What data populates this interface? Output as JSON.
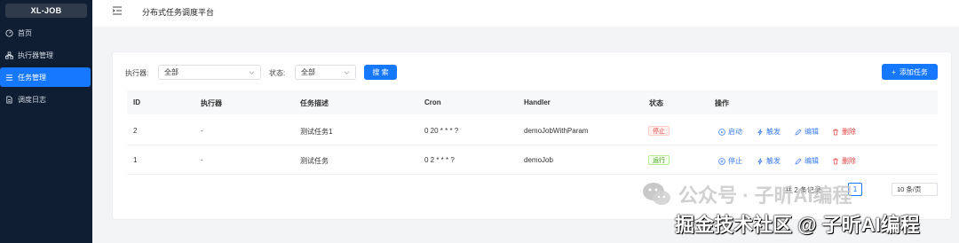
{
  "sidebar": {
    "logo": "XL-JOB",
    "items": [
      {
        "label": "首页",
        "icon": "dashboard-icon",
        "active": false
      },
      {
        "label": "执行器管理",
        "icon": "cluster-icon",
        "active": false
      },
      {
        "label": "任务管理",
        "icon": "list-icon",
        "active": true
      },
      {
        "label": "调度日志",
        "icon": "file-icon",
        "active": false
      }
    ]
  },
  "header": {
    "title": "分布式任务调度平台"
  },
  "filters": {
    "executor_label": "执行器:",
    "executor_value": "全部",
    "status_label": "状态:",
    "status_value": "全部",
    "search_label": "搜 索",
    "add_label": "添加任务"
  },
  "table": {
    "columns": [
      "ID",
      "执行器",
      "任务描述",
      "Cron",
      "Handler",
      "状态",
      "操作"
    ],
    "rows": [
      {
        "id": "2",
        "executor": "-",
        "desc": "测试任务1",
        "cron": "0 20 * * * ?",
        "handler": "demoJobWithParam",
        "status": "停止",
        "status_type": "stop",
        "toggle": "启动"
      },
      {
        "id": "1",
        "executor": "-",
        "desc": "测试任务",
        "cron": "0 2 * * * ?",
        "handler": "demoJob",
        "status": "运行",
        "status_type": "run",
        "toggle": "停止"
      }
    ],
    "actions": {
      "trigger": "触发",
      "edit": "编辑",
      "delete": "删除"
    }
  },
  "pagination": {
    "total": "共 2 条记录",
    "current": "1",
    "page_size": "10 条/页"
  },
  "watermark": {
    "line1": "公众号 · 子昕AI编程",
    "line2": "掘金技术社区 @ 子昕AI编程"
  },
  "colors": {
    "primary": "#1677ff",
    "sidebar_bg": "#0f1e33",
    "danger": "#e54545",
    "success": "#389e0d"
  }
}
